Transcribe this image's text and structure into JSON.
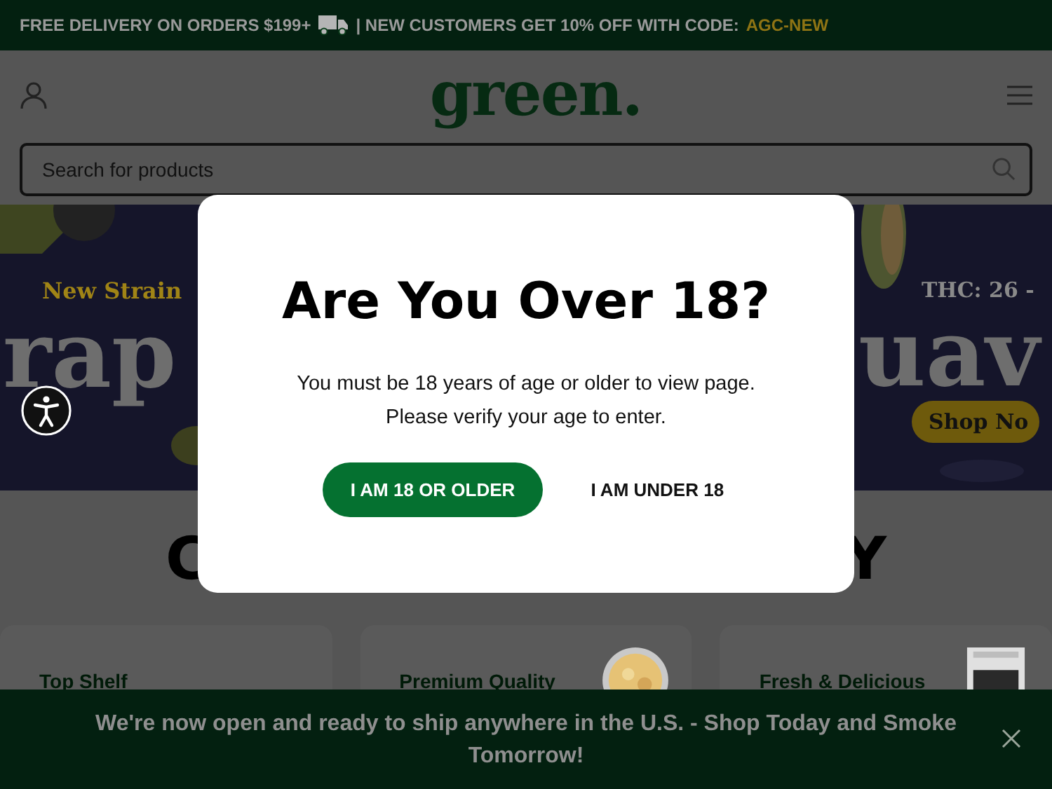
{
  "announcement": {
    "text": "FREE DELIVERY ON ORDERS $199+",
    "text_2": "| NEW CUSTOMERS GET 10% OFF WITH CODE:",
    "code": "AGC-NEW"
  },
  "header": {
    "logo": "green.",
    "search": {
      "placeholder": "Search for products"
    }
  },
  "hero": {
    "left": {
      "tag": "New Strain",
      "word": "rap"
    },
    "right": {
      "tag": "THC: 26 -",
      "word": "uav",
      "button": "Shop No"
    }
  },
  "section_heading": {
    "left": "C",
    "right": "Y"
  },
  "cards": [
    {
      "title": "Top Shelf",
      "kind": "plain"
    },
    {
      "title": "Premium Quality",
      "kind": "jar"
    },
    {
      "title": "Fresh & Delicious",
      "kind": "bag"
    }
  ],
  "modal": {
    "title": "Are You Over 18?",
    "lines": [
      "You must be 18 years of age or older to view page.",
      "Please verify your age to enter."
    ],
    "confirm": "I AM 18 OR OLDER",
    "decline": "I AM UNDER 18"
  },
  "bottom_banner": {
    "text": "We're now open and ready to ship anywhere in the U.S. - Shop Today and Smoke Tomorrow!"
  }
}
